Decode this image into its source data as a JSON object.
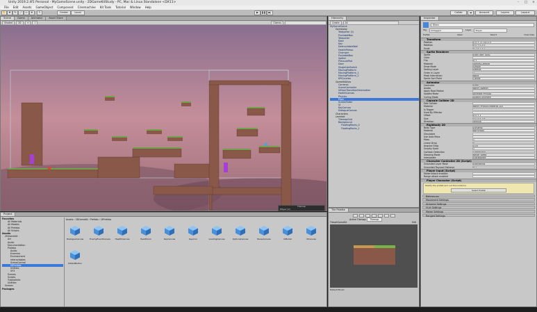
{
  "window": {
    "title": "Unity 2019.2.4f1 Personal - MyGameScene.unity - 2DGameKitStudy - PC, Mac & Linux Standalone <DX11>"
  },
  "menu": [
    "File",
    "Edit",
    "Assets",
    "GameObject",
    "Component",
    "Cinemachine",
    "Kit Tools",
    "Tutorial",
    "Window",
    "Help"
  ],
  "toolbar": {
    "center": "Center",
    "local": "Local",
    "collab": "Collab",
    "account": "Account",
    "layers": "Layers",
    "layout": "Layout"
  },
  "scene_tabs": [
    "Scene",
    "Game",
    "Animator",
    "Asset Store"
  ],
  "scene_bar": {
    "shaded": "Shaded",
    "mode": "2D",
    "gizmos": "Gizmos"
  },
  "hierarchy": {
    "tab": "Hierarchy",
    "create": "Create",
    "search_placeholder": "All",
    "rows": [
      "MyGameScene",
      "Gameplay",
      "Teleporter (1)",
      "PushableBox",
      "Teleporter",
      "Door",
      "Key",
      "DestructableWall",
      "HealthPickup",
      "Chomper",
      "PushableBox",
      "Spitter",
      "PressurePad",
      "Door",
      "SingleUseSwitch",
      "MovingPlatform",
      "MovingPlatform_1",
      "MovingPlatform_2",
      "KPICounter",
      "GameUtilities",
      "Cameras",
      "SceneController",
      "UIDoorTransitionDestination",
      "HealthCanvas",
      "Physics",
      "Ellen",
      "ScreenFader",
      "UI",
      "KeyCanvas",
      "DialogueCanvas",
      "Characters",
      "Levelart",
      "TilemapGrid",
      "Background",
      "FloatingRocks_0",
      "FloatingRocks_1"
    ],
    "selected": "Ellen"
  },
  "tile_palette": {
    "tab": "Tile Palette",
    "active": "Active Tilemap",
    "tilemap": "Tilemap",
    "palette": "TilesetGameKit",
    "edit": "Edit",
    "brush": "Default Brush"
  },
  "inspector": {
    "tab": "Inspector",
    "name": "Ellen",
    "tag": "Untagged",
    "layer": "Player",
    "prefab": [
      "Prefab",
      "Open",
      "Select",
      "Overrides"
    ],
    "components": [
      {
        "title": "Transform",
        "rows": [
          [
            "Position",
            "X 0    Y -3.714   Z 0"
          ],
          [
            "Rotation",
            "X 0    Y 0   Z 0"
          ],
          [
            "Scale",
            "X 1    Y 1   Z 1"
          ]
        ]
      },
      {
        "title": "Sprite Renderer",
        "rows": [
          [
            "Sprite",
            "Ellen_Idle_0001"
          ],
          [
            "Color",
            ""
          ],
          [
            "Flip",
            "X  Y"
          ],
          [
            "Material",
            "Sprites-Default"
          ],
          [
            "Draw Mode",
            "Simple"
          ],
          [
            "Sorting Layer",
            "Default"
          ],
          [
            "Order in Layer",
            "2"
          ],
          [
            "Mask Interaction",
            "None"
          ],
          [
            "Sprite Sort Point",
            "Center"
          ]
        ]
      },
      {
        "title": "Animator",
        "rows": [
          [
            "Controller",
            "Ellen"
          ],
          [
            "Avatar",
            "None (Avatar)"
          ],
          [
            "Apply Root Motion",
            ""
          ],
          [
            "Update Mode",
            "Animate Physics"
          ],
          [
            "Culling Mode",
            "Always Animate"
          ]
        ]
      },
      {
        "title": "Capsule Collider 2D",
        "rows": [
          [
            "Edit Collider",
            ""
          ],
          [
            "Material",
            "None (Physics Material 2D)"
          ],
          [
            "Is Trigger",
            ""
          ],
          [
            "Used By Effector",
            ""
          ],
          [
            "Offset",
            "X 0    Y 1"
          ],
          [
            "Size",
            "X 0.5  Y 1.9"
          ],
          [
            "Direction",
            "Vertical"
          ]
        ]
      },
      {
        "title": "Rigidbody 2D",
        "rows": [
          [
            "Body Type",
            "Dynamic"
          ],
          [
            "Material",
            "NoFriction"
          ],
          [
            "Simulated",
            ""
          ],
          [
            "Use Auto Mass",
            ""
          ],
          [
            "Mass",
            "1"
          ],
          [
            "Linear Drag",
            "0"
          ],
          [
            "Angular Drag",
            "0.05"
          ],
          [
            "Gravity Scale",
            "1"
          ],
          [
            "Collision Detection",
            "Continuous"
          ],
          [
            "Sleeping Mode",
            "Never Sleep"
          ],
          [
            "Interpolate",
            "Extrapolate"
          ]
        ]
      },
      {
        "title": "Character Controller 2D (Script)",
        "rows": [
          [
            "Grounded Layer Mask",
            "Everything"
          ],
          [
            "Grounded Raycast Distance",
            "0.1"
          ]
        ]
      },
      {
        "title": "Player Input (Script)",
        "rows": [
          [
            "Melee attack enabled",
            ""
          ],
          [
            "Range attack enabled",
            ""
          ]
        ]
      },
      {
        "title": "Player Character (Script)",
        "rows": []
      }
    ],
    "sections": [
      "References",
      "Movement Settings",
      "Airborne Settings",
      "Hurt Settings",
      "Melee Settings",
      "Ranged Settings"
    ],
    "warning": "Modify the prefab and not this instance",
    "select_prefab": "Select Prefab"
  },
  "project": {
    "tab": "Project",
    "tree": [
      "Favorites",
      "All Materials",
      "All Models",
      "All Prefabs",
      "All Scripts",
      "Assets",
      "2DGamekit",
      "Art",
      "Audio",
      "Documentation",
      "Prefabs",
      "Audio",
      "Enemies",
      "Environment",
      "Interactables",
      "SceneControl",
      "UIPrefabs",
      "Utilities",
      "VFX",
      "Scenes",
      "Scripts",
      "TutorialInfo",
      "Utilities",
      "Scenes",
      "Packages"
    ],
    "breadcrumb": [
      "Assets",
      "2DGamekit",
      "Prefabs",
      "UIPrefabs"
    ],
    "assets": [
      "DialogueCanvas",
      "EnemyEventCanvas",
      "HealthCanvas",
      "HealthIcon",
      "KeyCanvas",
      "KeyIcon",
      "LoadingCanvas",
      "OptionsCanvas",
      "PauseCanvas",
      "UIBullet",
      "UICanvas",
      "UIStartButton"
    ]
  },
  "game_overlay": {
    "title": "Tilemap",
    "label": "Player (V)"
  }
}
